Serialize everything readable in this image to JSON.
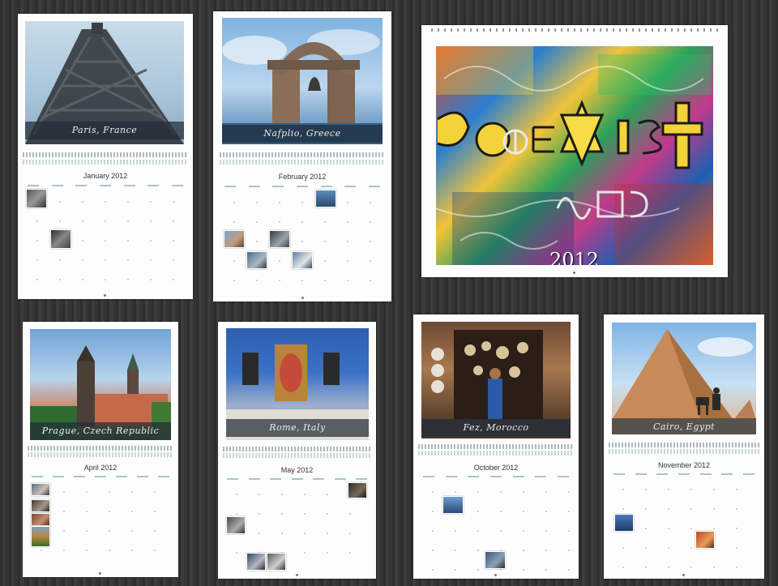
{
  "cover": {
    "year": "2012"
  },
  "calendars": [
    {
      "id": "january",
      "caption": "Paris, France",
      "month_title": "January 2012"
    },
    {
      "id": "february",
      "caption": "Nafplio, Greece",
      "month_title": "February 2012"
    },
    {
      "id": "april",
      "caption": "Prague, Czech Republic",
      "month_title": "April 2012"
    },
    {
      "id": "may",
      "caption": "Rome, Italy",
      "month_title": "May 2012"
    },
    {
      "id": "october",
      "caption": "Fez, Morocco",
      "month_title": "October 2012"
    },
    {
      "id": "november",
      "caption": "Cairo, Egypt",
      "month_title": "November 2012"
    }
  ],
  "colors": {
    "background": "#3a3a3a",
    "page": "#fdfdfd",
    "caption_bar": "#232d37",
    "weekday_accent": "#8fb6c9"
  }
}
